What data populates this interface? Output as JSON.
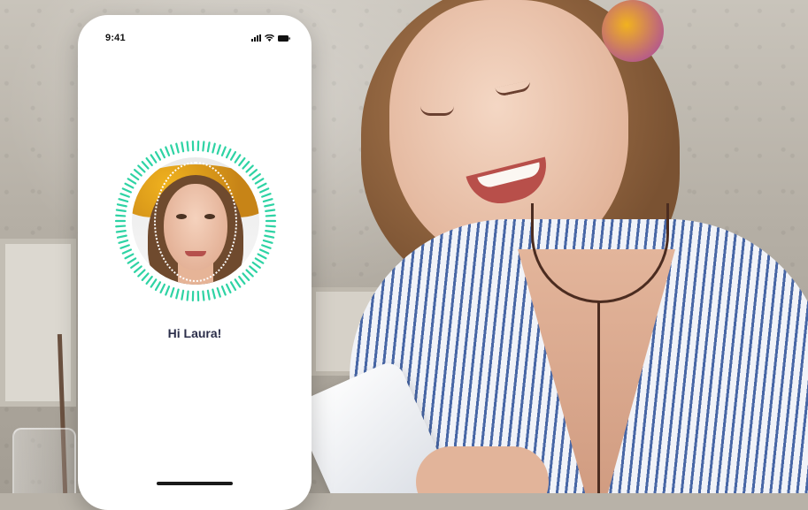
{
  "status_bar": {
    "time": "9:41",
    "icons": [
      "signal-icon",
      "wifi-icon",
      "battery-icon"
    ]
  },
  "face_scan": {
    "ring_color": "#2ed3a4",
    "oval_color": "#ffffff"
  },
  "greeting": "Hi Laura!",
  "colors": {
    "accent": "#2ed3a4",
    "text": "#2b2e4a",
    "phone_bg": "#ffffff"
  }
}
